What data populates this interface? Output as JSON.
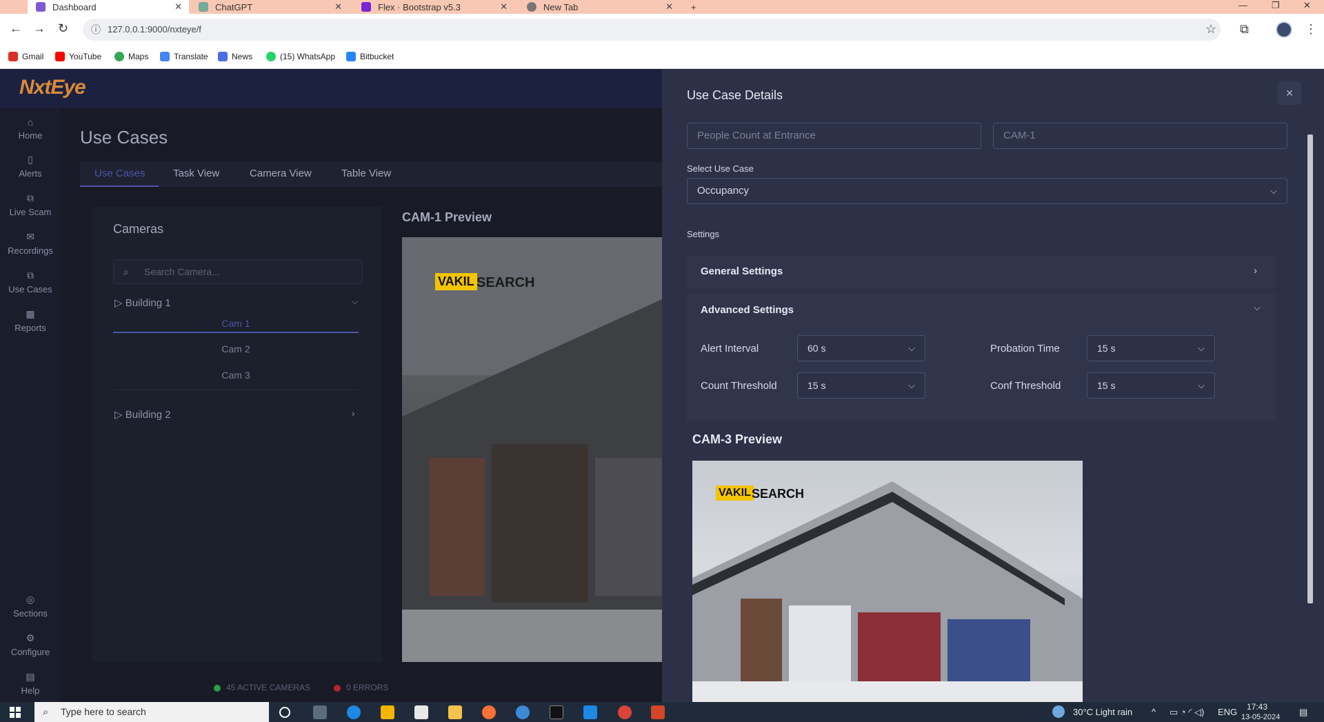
{
  "browser": {
    "tabs": [
      {
        "label": "Dashboard",
        "active": true
      },
      {
        "label": "ChatGPT",
        "active": false
      },
      {
        "label": "Flex · Bootstrap v5.3",
        "active": false
      },
      {
        "label": "New Tab",
        "active": false
      }
    ],
    "new_tab": "+",
    "url": "127.0.0.1:9000/nxteye/f",
    "bookmarks": [
      "Gmail",
      "YouTube",
      "Maps",
      "Translate",
      "News",
      "(15) WhatsApp",
      "Bitbucket"
    ]
  },
  "app": {
    "logo": "NxtEye",
    "nav": [
      {
        "label": "Home",
        "icon": "home-icon"
      },
      {
        "label": "Alerts",
        "icon": "alerts-icon"
      },
      {
        "label": "Live Scam",
        "icon": "live-icon"
      },
      {
        "label": "Recordings",
        "icon": "recordings-icon"
      },
      {
        "label": "Use Cases",
        "icon": "usecases-icon"
      },
      {
        "label": "Reports",
        "icon": "reports-icon"
      },
      {
        "label": "Sections",
        "icon": "sections-icon"
      },
      {
        "label": "Configure",
        "icon": "configure-icon"
      },
      {
        "label": "Help",
        "icon": "help-icon"
      }
    ],
    "page_title": "Use Cases",
    "tabs": [
      "Use Cases",
      "Task View",
      "Camera View",
      "Table View"
    ],
    "cameras_title": "Cameras",
    "camera_search_placeholder": "Search Camera...",
    "buildings": [
      {
        "name": "Building 1",
        "cams": [
          "Cam 1",
          "Cam 2",
          "Cam 3"
        ],
        "expanded": true
      },
      {
        "name": "Building 2",
        "cams": [],
        "expanded": false
      }
    ],
    "preview_title": "CAM-1 Preview",
    "status": {
      "active": "45 ACTIVE CAMERAS",
      "errors": "0 ERRORS",
      "active_color": "#2e9b4a",
      "error_color": "#b3262e"
    }
  },
  "drawer": {
    "title": "Use Case Details",
    "close_label": "×",
    "name_placeholder": "People Count at Entrance",
    "camera_placeholder": "CAM-1",
    "select_use_case_label": "Select Use Case",
    "use_case_value": "Occupancy",
    "settings_label": "Settings",
    "general_settings": "General Settings",
    "advanced_settings": "Advanced Settings",
    "alert_interval_label": "Alert Interval",
    "alert_interval_value": "60 s",
    "probation_time_label": "Probation Time",
    "probation_time_value": "15 s",
    "count_threshold_label": "Count Threshold",
    "count_threshold_value": "15 s",
    "conf_threshold_label": "Conf Threshold",
    "conf_threshold_value": "15 s",
    "cam3_title": "CAM-3 Preview"
  },
  "image_text": {
    "brand_a": "VAKIL",
    "brand_b": "SEARCH"
  },
  "taskbar": {
    "search_placeholder": "Type here to search",
    "weather": "30°C  Light rain",
    "lang": "ENG",
    "time": "17:43",
    "date": "13-05-2024"
  }
}
